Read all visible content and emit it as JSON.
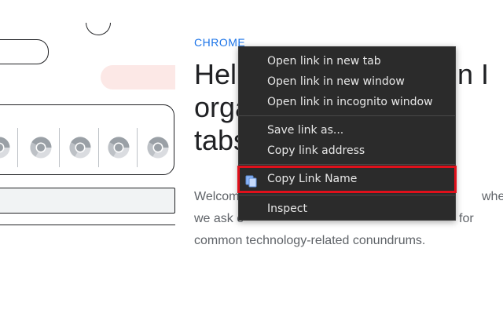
{
  "article": {
    "eyebrow": "CHROME",
    "headline_lines": [
      "Help",
      "orga",
      "tabs"
    ],
    "headline_right": "n I",
    "body_lines": [
      "Welcom",
      "we ask e",
      "common technology-related conundrums."
    ],
    "body_right": [
      "where",
      "for"
    ]
  },
  "illustration": {
    "chrome_icon_count": 5,
    "icon": "chrome-icon"
  },
  "context_menu": {
    "items": [
      {
        "label": "Open link in new tab"
      },
      {
        "label": "Open link in new window"
      },
      {
        "label": "Open link in incognito window"
      },
      {
        "label": "Save link as..."
      },
      {
        "label": "Copy link address"
      },
      {
        "label": "Copy Link Name",
        "icon": "copy-icon",
        "highlighted": true
      },
      {
        "label": "Inspect"
      }
    ]
  },
  "colors": {
    "accent": "#1a73e8",
    "menu_bg": "#2b2b2b",
    "highlight_border": "#e0101b"
  }
}
